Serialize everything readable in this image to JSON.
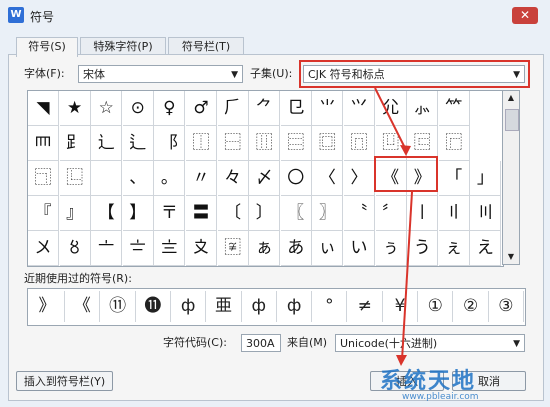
{
  "window": {
    "title": "符号",
    "icon": "W",
    "close": "✕"
  },
  "tabs": [
    {
      "label": "符号(S)"
    },
    {
      "label": "特殊字符(P)"
    },
    {
      "label": "符号栏(T)"
    }
  ],
  "font": {
    "label": "字体(F):",
    "value": "宋体"
  },
  "subset": {
    "label": "子集(U):",
    "value": "CJK 符号和标点"
  },
  "grid_rows": [
    [
      "◥",
      "★",
      "☆",
      "⊙",
      "♀",
      "♂",
      "⺁",
      "⺈",
      "⺋",
      "⺌",
      "⺍",
      "⺏",
      "⺗",
      "⺮"
    ],
    [
      "⺵",
      "⻊",
      "⻌",
      "⻍",
      "⻏",
      "⿰",
      "⿱",
      "⿲",
      "⿳",
      "⿴",
      "⿵",
      "⿶",
      "⿷",
      "⿸"
    ],
    [
      "⿹",
      "⿺",
      "",
      "、",
      "。",
      "〃",
      "々",
      "〆",
      "〇",
      "〈",
      "〉",
      "《",
      "》",
      "「",
      "」"
    ],
    [
      "『",
      "』",
      "【",
      "】",
      "〒",
      "〓",
      "〔",
      "〕",
      "〖",
      "〗",
      "〝",
      "〞",
      "〡",
      "〢",
      "〣"
    ],
    [
      "〤",
      "〥",
      "〦",
      "〧",
      "〨",
      "〩",
      "〾",
      "ぁ",
      "あ",
      "ぃ",
      "い",
      "ぅ",
      "う",
      "ぇ",
      "え"
    ]
  ],
  "recent": {
    "label": "近期使用过的符号(R):",
    "items": [
      "》",
      "《",
      "⑪",
      "⓫",
      "ф",
      "亜",
      "ф",
      "ф",
      "°",
      "≠",
      "¥",
      "①",
      "②",
      "③"
    ]
  },
  "char_code": {
    "label": "字符代码(C):",
    "value": "300A",
    "from_label": "来自(M)",
    "from_value": "Unicode(十六进制)"
  },
  "buttons": {
    "insert_bar": "插入到符号栏(Y)",
    "insert": "插入",
    "cancel": "取消"
  },
  "watermark": {
    "text": "系统天地",
    "url": "www.pbleair.com"
  },
  "accent": "#d9342b"
}
